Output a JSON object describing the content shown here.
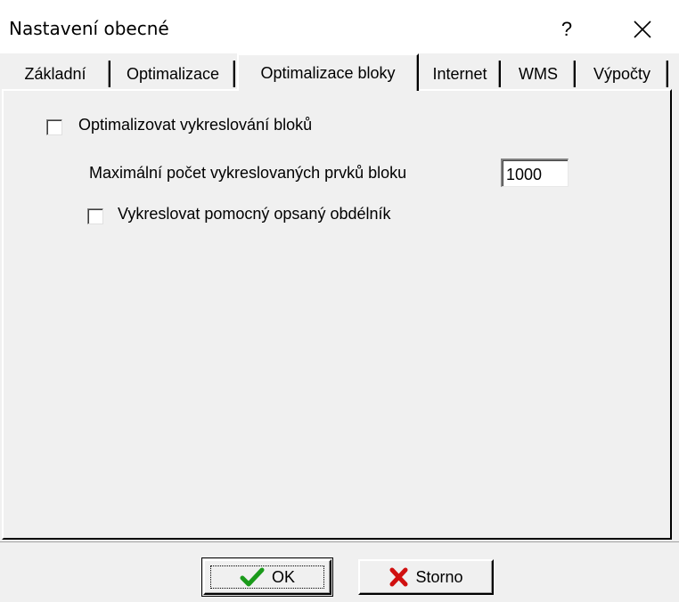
{
  "window": {
    "title": "Nastavení obecné",
    "help_label": "?",
    "close_icon": "close-icon"
  },
  "tabs": [
    {
      "label": "Základní",
      "active": false
    },
    {
      "label": "Optimalizace",
      "active": false
    },
    {
      "label": "Optimalizace bloky",
      "active": true
    },
    {
      "label": "Internet",
      "active": false
    },
    {
      "label": "WMS",
      "active": false
    },
    {
      "label": "Výpočty",
      "active": false
    }
  ],
  "panel": {
    "optimize_blocks": {
      "label": "Optimalizovat vykreslování bloků",
      "checked": false
    },
    "max_elements": {
      "label": "Maximální počet vykreslovaných prvků bloku",
      "value": "1000"
    },
    "draw_bbox": {
      "label": "Vykreslovat pomocný opsaný obdélník",
      "checked": false
    }
  },
  "buttons": {
    "ok_label": "OK",
    "ok_icon": "checkmark-icon",
    "ok_icon_color": "#1a9a1a",
    "cancel_label": "Storno",
    "cancel_icon": "x-mark-icon",
    "cancel_icon_color": "#d01010"
  }
}
